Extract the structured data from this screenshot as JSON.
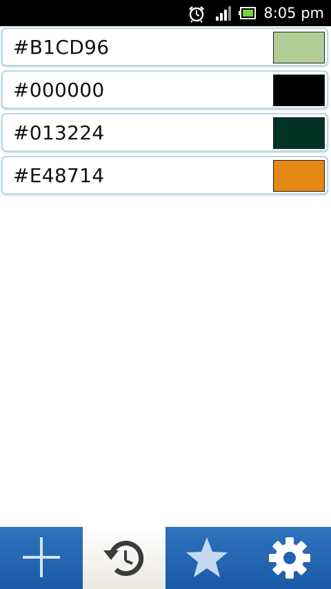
{
  "status_bar": {
    "time": "8:05 pm",
    "icons": [
      "alarm-clock-icon",
      "signal-strength-icon",
      "battery-icon"
    ]
  },
  "colors": [
    {
      "hex": "#B1CD96",
      "swatch": "#B1CD96"
    },
    {
      "hex": "#000000",
      "swatch": "#000000"
    },
    {
      "hex": "#013224",
      "swatch": "#013224"
    },
    {
      "hex": "#E48714",
      "swatch": "#E48714"
    }
  ],
  "tabs": [
    {
      "icon": "plus-icon",
      "selected": false
    },
    {
      "icon": "history-icon",
      "selected": true
    },
    {
      "icon": "star-icon",
      "selected": false
    },
    {
      "icon": "gear-icon",
      "selected": false
    }
  ],
  "theme": {
    "tab_blue": "#1f62ad",
    "row_border": "#b9d9e4"
  }
}
